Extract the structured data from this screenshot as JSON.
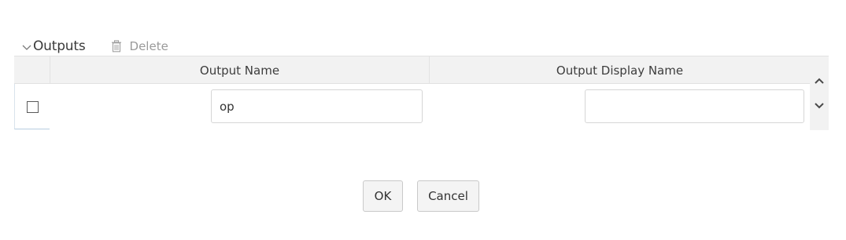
{
  "section": {
    "title": "Outputs",
    "delete_label": "Delete"
  },
  "grid": {
    "columns": [
      "Output Name",
      "Output Display Name"
    ],
    "rows": [
      {
        "selected": false,
        "output_name": "op",
        "output_display_name": ""
      }
    ]
  },
  "footer": {
    "ok_label": "OK",
    "cancel_label": "Cancel"
  },
  "icons": {
    "collapse": "chevron-down-icon",
    "delete": "trash-icon",
    "scroll_up": "chevron-up-icon",
    "scroll_down": "chevron-down-icon"
  },
  "colors": {
    "header_bg": "#f2f2f2",
    "row_accent_border": "#b8cde0",
    "muted_text": "#9a9a9a"
  }
}
